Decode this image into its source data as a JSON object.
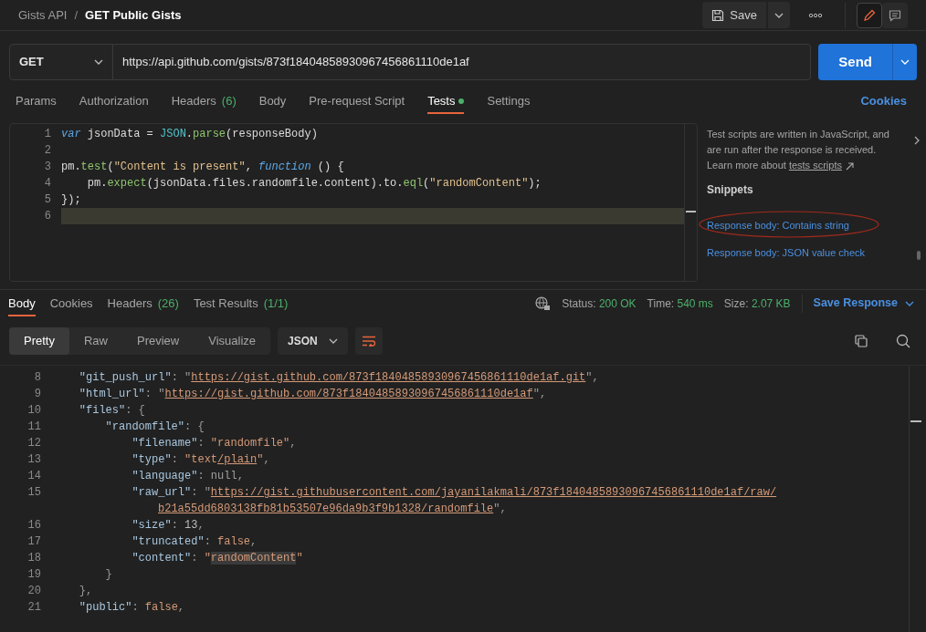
{
  "breadcrumb": [
    {
      "text": "Gists API",
      "current": false
    },
    {
      "text": "GET Public Gists",
      "current": true
    }
  ],
  "breadcrumb_separator": "/",
  "save_button": "Save",
  "editor_modes": [
    {
      "kind": "edit",
      "selected": true
    },
    {
      "kind": "comment",
      "selected": false
    }
  ],
  "request": {
    "method": "GET",
    "url": "https://api.github.com/gists/873f18404858930967456861110de1af",
    "send": "Send"
  },
  "request_tabs": [
    {
      "label": "Params",
      "selected": false
    },
    {
      "label": "Authorization",
      "selected": false
    },
    {
      "label": "Headers",
      "count": "(6)",
      "selected": false
    },
    {
      "label": "Body",
      "selected": false
    },
    {
      "label": "Pre-request Script",
      "selected": false
    },
    {
      "label": "Tests",
      "dot": true,
      "selected": true
    },
    {
      "label": "Settings",
      "selected": false
    }
  ],
  "cookies_link": "Cookies",
  "test_script": [
    {
      "number": "1",
      "current": false,
      "segments": [
        {
          "kind": "keyword",
          "text": "var"
        },
        {
          "kind": "plain",
          "text": " jsonData = "
        },
        {
          "kind": "builtin",
          "text": "JSON"
        },
        {
          "kind": "plain",
          "text": "."
        },
        {
          "kind": "method",
          "text": "parse"
        },
        {
          "kind": "plain",
          "text": "(responseBody)"
        }
      ]
    },
    {
      "number": "2",
      "current": false
    },
    {
      "number": "3",
      "current": false,
      "segments": [
        {
          "kind": "plain",
          "text": "pm."
        },
        {
          "kind": "method",
          "text": "test"
        },
        {
          "kind": "plain",
          "text": "("
        },
        {
          "kind": "string",
          "text": "\"Content is present\""
        },
        {
          "kind": "plain",
          "text": ", "
        },
        {
          "kind": "keyword",
          "text": "function"
        },
        {
          "kind": "plain",
          "text": " () {"
        }
      ]
    },
    {
      "number": "4",
      "current": false,
      "segments": [
        {
          "kind": "plain",
          "text": "    pm."
        },
        {
          "kind": "method",
          "text": "expect"
        },
        {
          "kind": "plain",
          "text": "(jsonData.files.randomfile.content).to."
        },
        {
          "kind": "method",
          "text": "eql"
        },
        {
          "kind": "plain",
          "text": "("
        },
        {
          "kind": "string",
          "text": "\"randomContent\""
        },
        {
          "kind": "plain",
          "text": ");"
        }
      ]
    },
    {
      "number": "5",
      "current": false,
      "segments": [
        {
          "kind": "plain",
          "text": "});"
        }
      ]
    },
    {
      "number": "6",
      "current": true
    }
  ],
  "side_panel": {
    "description": "Test scripts are written in JavaScript, and are run after the response is received. Learn more about",
    "link": "tests scripts",
    "snippets_title": "Snippets",
    "snippets": [
      {
        "text": "Response body: Contains string",
        "circled": true
      },
      {
        "text": "Response body: JSON value check",
        "circled": false
      }
    ]
  },
  "response_tabs": [
    {
      "label": "Body",
      "selected": true
    },
    {
      "label": "Cookies",
      "selected": false
    },
    {
      "label": "Headers",
      "count": "(26)",
      "selected": false
    },
    {
      "label": "Test Results",
      "count": "(1/1)",
      "selected": false
    }
  ],
  "response_meta": [
    {
      "label": "Status:",
      "value": "200 OK"
    },
    {
      "label": "Time:",
      "value": "540 ms"
    },
    {
      "label": "Size:",
      "value": "2.07 KB"
    }
  ],
  "save_response": "Save Response",
  "view_modes": [
    {
      "label": "Pretty",
      "selected": true
    },
    {
      "label": "Raw",
      "selected": false
    },
    {
      "label": "Preview",
      "selected": false
    },
    {
      "label": "Visualize",
      "selected": false
    }
  ],
  "format": "JSON",
  "response_body": [
    {
      "number": "8",
      "segments": [
        {
          "kind": "key",
          "text": "    \"git_push_url\""
        },
        {
          "kind": "punct",
          "text": ": \""
        },
        {
          "kind": "link",
          "text": "https://gist.github.com/873f18404858930967456861110de1af.git"
        },
        {
          "kind": "punct",
          "text": "\","
        }
      ]
    },
    {
      "number": "9",
      "segments": [
        {
          "kind": "key",
          "text": "    \"html_url\""
        },
        {
          "kind": "punct",
          "text": ": \""
        },
        {
          "kind": "link",
          "text": "https://gist.github.com/873f18404858930967456861110de1af"
        },
        {
          "kind": "punct",
          "text": "\","
        }
      ]
    },
    {
      "number": "10",
      "segments": [
        {
          "kind": "key",
          "text": "    \"files\""
        },
        {
          "kind": "punct",
          "text": ": {"
        }
      ]
    },
    {
      "number": "11",
      "segments": [
        {
          "kind": "key",
          "text": "        \"randomfile\""
        },
        {
          "kind": "punct",
          "text": ": {"
        }
      ]
    },
    {
      "number": "12",
      "segments": [
        {
          "kind": "key",
          "text": "            \"filename\""
        },
        {
          "kind": "punct",
          "text": ": "
        },
        {
          "kind": "string",
          "text": "\"randomfile\""
        },
        {
          "kind": "punct",
          "text": ","
        }
      ]
    },
    {
      "number": "13",
      "segments": [
        {
          "kind": "key",
          "text": "            \"type\""
        },
        {
          "kind": "punct",
          "text": ": "
        },
        {
          "kind": "string",
          "text": "\"text"
        },
        {
          "kind": "link",
          "text": "/plain"
        },
        {
          "kind": "string",
          "text": "\""
        },
        {
          "kind": "punct",
          "text": ","
        }
      ]
    },
    {
      "number": "14",
      "segments": [
        {
          "kind": "key",
          "text": "            \"language\""
        },
        {
          "kind": "punct",
          "text": ": "
        },
        {
          "kind": "null",
          "text": "null"
        },
        {
          "kind": "punct",
          "text": ","
        }
      ]
    },
    {
      "number": "15",
      "segments": [
        {
          "kind": "key",
          "text": "            \"raw_url\""
        },
        {
          "kind": "punct",
          "text": ": \""
        },
        {
          "kind": "link",
          "text": "https://gist.githubusercontent.com/jayanilakmali/873f18404858930967456861110de1af/raw/"
        }
      ]
    },
    {
      "segments": [
        {
          "kind": "link",
          "text": "b21a55dd6803138fb81b53507e96da9b3f9b1328/randomfile"
        },
        {
          "kind": "punct",
          "text": "\","
        }
      ]
    },
    {
      "number": "16",
      "segments": [
        {
          "kind": "key",
          "text": "            \"size\""
        },
        {
          "kind": "punct",
          "text": ": "
        },
        {
          "kind": "number",
          "text": "13"
        },
        {
          "kind": "punct",
          "text": ","
        }
      ]
    },
    {
      "number": "17",
      "segments": [
        {
          "kind": "key",
          "text": "            \"truncated\""
        },
        {
          "kind": "punct",
          "text": ": "
        },
        {
          "kind": "boolean",
          "text": "false"
        },
        {
          "kind": "punct",
          "text": ","
        }
      ]
    },
    {
      "number": "18",
      "segments": [
        {
          "kind": "key",
          "text": "            \"content\""
        },
        {
          "kind": "punct",
          "text": ": "
        },
        {
          "kind": "string",
          "text": "\""
        },
        {
          "kind": "match",
          "text": "randomContent"
        },
        {
          "kind": "string",
          "text": "\""
        }
      ]
    },
    {
      "number": "19",
      "segments": [
        {
          "kind": "punct",
          "text": "        }"
        }
      ]
    },
    {
      "number": "20",
      "segments": [
        {
          "kind": "punct",
          "text": "    },"
        }
      ]
    },
    {
      "number": "21",
      "segments": [
        {
          "kind": "key",
          "text": "    \"public\""
        },
        {
          "kind": "punct",
          "text": ": "
        },
        {
          "kind": "boolean",
          "text": "false"
        },
        {
          "kind": "punct",
          "text": ","
        }
      ]
    }
  ]
}
